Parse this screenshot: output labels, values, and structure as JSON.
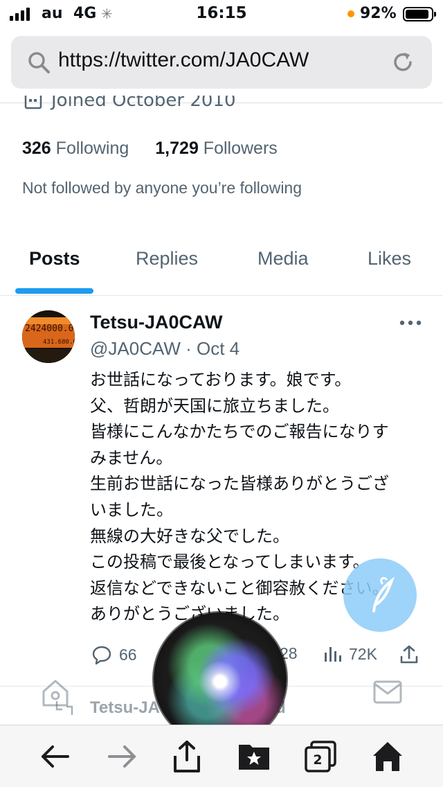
{
  "status_bar": {
    "carrier": "au",
    "network": "4G",
    "time": "16:15",
    "battery": "92%",
    "battery_level": 0.92,
    "signal_bars": 4
  },
  "browser": {
    "url": "https://twitter.com/JA0CAW",
    "toolbar_icons": [
      "back-arrow-icon",
      "forward-arrow-icon",
      "share-icon",
      "bookmarks-icon",
      "tabs-icon",
      "home-icon"
    ],
    "tab_count": "2"
  },
  "profile": {
    "joined": "Joined October 2010",
    "following_count": "326",
    "following_label": "Following",
    "followers_count": "1,729",
    "followers_label": "Followers",
    "not_followed_note": "Not followed by anyone you’re following"
  },
  "tabs": [
    {
      "label": "Posts",
      "active": true
    },
    {
      "label": "Replies",
      "active": false
    },
    {
      "label": "Media",
      "active": false
    },
    {
      "label": "Likes",
      "active": false
    }
  ],
  "tweet": {
    "author": "Tetsu-JA0CAW",
    "handle": "@JA0CAW · Oct 4",
    "lines": [
      "お世話になっております。娘です。",
      "父、哲朗が天国に旅立ちました。",
      "皆様にこんなかたちでのご報告になりす",
      "みません。",
      "生前お世話になった皆様ありがとうござ",
      "いました。",
      "無線の大好きな父でした。",
      "この投稿で最後となってしまいます。",
      "返信などできないこと御容赦ください。",
      "ありがとうございました。"
    ],
    "replies": "66",
    "likes_partial": "28",
    "views": "72K"
  },
  "next_tweet": {
    "author_partial": "Tetsu-JA",
    "suffix_partial": "d"
  },
  "colors": {
    "accent": "#1d9bf0",
    "secondary_text": "#536471",
    "fab": "#8ecdf8"
  }
}
